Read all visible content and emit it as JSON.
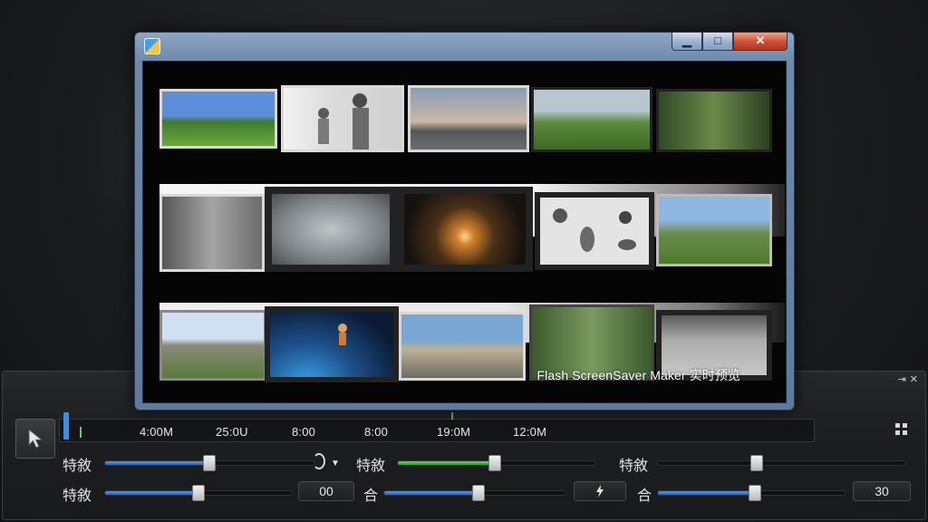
{
  "preview_window": {
    "caption": "Flash ScreenSaver Maker 实时预览",
    "min_label": "▁",
    "max_label": "□",
    "close_label": "✕"
  },
  "panel": {
    "pin_label": "⇥",
    "close_label": "✕",
    "timeline": {
      "labels": [
        "4:00M",
        "25:0U",
        "8:00",
        "8:00",
        "19:0M",
        "12:0M"
      ]
    },
    "row1": {
      "label1": "特敘",
      "label2": "特敘",
      "label3": "特敘",
      "slider1": 0.5,
      "slider2": 0.49,
      "slider3": 0.4
    },
    "row2": {
      "label1": "特敘",
      "value1": "00",
      "label2": "合",
      "label3": "合",
      "value3": "30",
      "slider1": 0.5,
      "slider2": 0.52,
      "slider3": 0.52
    }
  },
  "colors": {
    "accent_blue": "#3b8ee8",
    "accent_green": "#48c848",
    "close_red": "#d0513a"
  }
}
